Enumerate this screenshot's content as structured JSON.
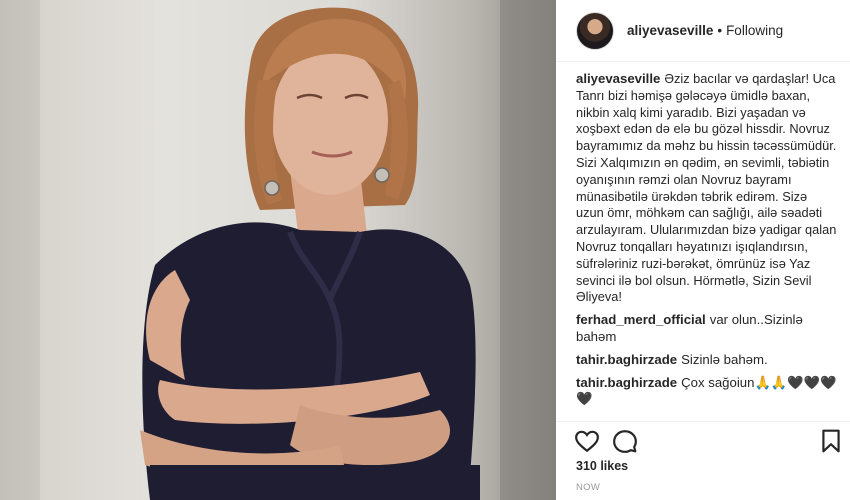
{
  "post": {
    "username": "aliyevaseville",
    "separator": "•",
    "follow_status": "Following",
    "caption": "Əziz bacılar və qardaşlar! Uca Tanrı bizi həmişə gələcəyə ümidlə baxan, nikbin xalq kimi yaradıb. Bizi yaşadan və xoşbəxt edən də elə bu gözəl hissdir. Novruz bayramımız da məhz bu hissin təcəssümüdür. Sizi Xalqımızın ən qədim, ən sevimli, təbiətin oyanışının rəmzi olan Novruz bayramı münasibətilə ürəkdən təbrik edirəm. Sizə uzun ömr, möhkəm can sağlığı, ailə səadəti arzulayıram. Ulularımızdan bizə yadigar qalan Novruz tonqalları həyatınızı işıqlandırsın, süfrələriniz ruzi-bərəkət, ömrünüz isə Yaz sevinci ilə bol olsun. Hörmətlə, Sizin Sevil Əliyeva!",
    "likes": "310 likes",
    "timestamp": "NOW"
  },
  "comments": [
    {
      "user": "ferhad_merd_official",
      "text": "var olun..Sizinlə bahəm"
    },
    {
      "user": "tahir.baghirzade",
      "text": "Sizinlə bahəm."
    },
    {
      "user": "tahir.baghirzade",
      "text": "Çox sağoiun🙏🙏🖤🖤🖤🖤"
    }
  ],
  "icons": {
    "like": "heart-icon",
    "comment": "speech-bubble-icon",
    "save": "bookmark-icon"
  },
  "colors": {
    "text": "#262626",
    "muted": "#999999",
    "divider": "#efefef",
    "dress": "#1e1d32",
    "hair": "#b5784b"
  }
}
